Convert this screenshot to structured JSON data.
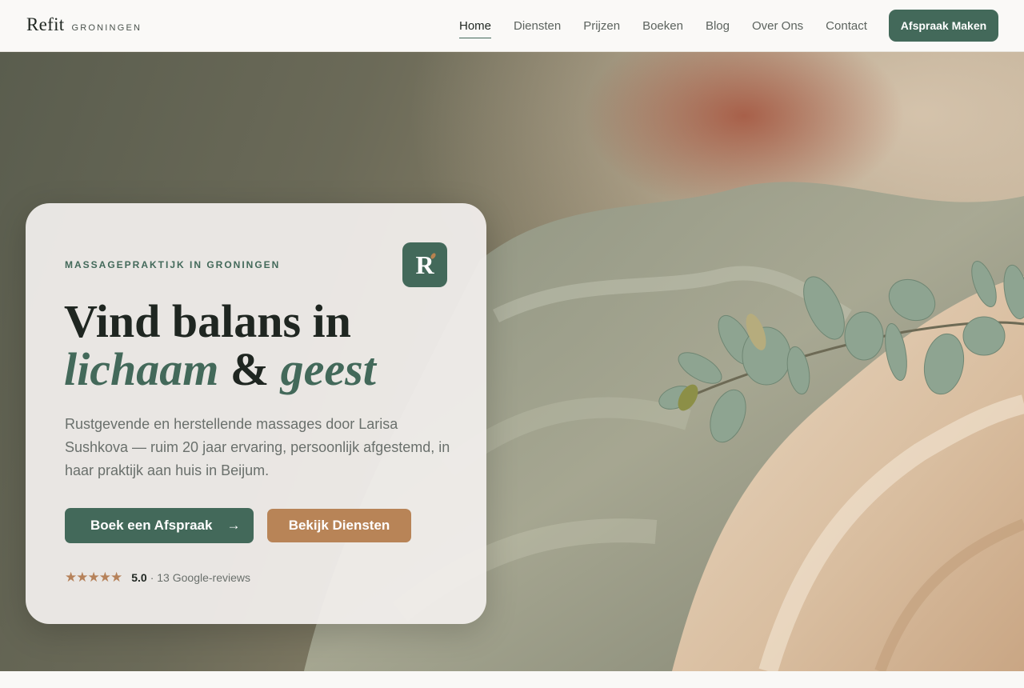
{
  "brand": {
    "name": "Refit",
    "city": "GRONINGEN"
  },
  "nav": {
    "links": [
      {
        "label": "Home",
        "active": true
      },
      {
        "label": "Diensten"
      },
      {
        "label": "Prijzen"
      },
      {
        "label": "Boeken"
      },
      {
        "label": "Blog"
      },
      {
        "label": "Over Ons"
      },
      {
        "label": "Contact"
      }
    ],
    "cta": "Afspraak Maken"
  },
  "hero": {
    "eyebrow": "MASSAGEPRAKTIJK IN GRONINGEN",
    "badge_letter": "R",
    "headline_line1": "Vind balans in",
    "headline_em1": "lichaam",
    "headline_amp": "&",
    "headline_em2": "geest",
    "description": "Rustgevende en herstellende massages door Larisa Sushkova — ruim 20 jaar ervaring, persoonlijk afgestemd, in haar praktijk aan huis in Beijum.",
    "primary_button": "Boek een Afspraak",
    "primary_arrow": "→",
    "secondary_button": "Bekijk Diensten",
    "rating": {
      "stars": 5,
      "score": "5.0",
      "reviews": "· 13 Google-reviews"
    }
  },
  "colors": {
    "accent_green": "#43695a",
    "accent_copper": "#b88457",
    "text_dark": "#1f2621"
  },
  "icons": [
    "star-icon",
    "arrow-right-icon",
    "logo-badge-icon",
    "eucalyptus-image"
  ]
}
